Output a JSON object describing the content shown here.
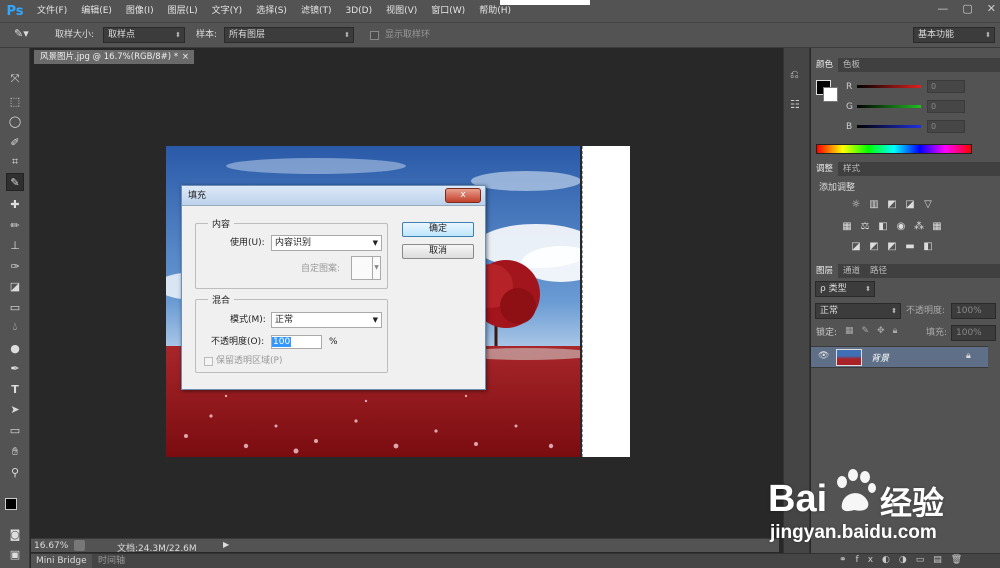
{
  "app": {
    "logo": "Ps"
  },
  "menu": [
    "文件(F)",
    "编辑(E)",
    "图像(I)",
    "图层(L)",
    "文字(Y)",
    "选择(S)",
    "滤镜(T)",
    "3D(D)",
    "视图(V)",
    "窗口(W)",
    "帮助(H)"
  ],
  "window_controls": {
    "minimize": "—",
    "restore": "▢",
    "close": "✕"
  },
  "options": {
    "sample_size_label": "取样大小:",
    "sample_size_value": "取样点",
    "sample_label": "样本:",
    "sample_value": "所有图层",
    "show_ring_label": "显示取样环",
    "workspace_value": "基本功能"
  },
  "document": {
    "tab_title": "风景图片.jpg @ 16.7%(RGB/8#) *",
    "close_glyph": "×"
  },
  "dialog": {
    "title": "填充",
    "close_glyph": "x",
    "content_group_title": "内容",
    "use_label": "使用(U):",
    "use_value": "内容识别",
    "custom_pattern_label": "自定图案:",
    "blend_group_title": "混合",
    "mode_label": "模式(M):",
    "mode_value": "正常",
    "opacity_label": "不透明度(O):",
    "opacity_value": "100",
    "opacity_unit": "%",
    "preserve_label": "保留透明区域(P)",
    "ok_label": "确定",
    "cancel_label": "取消"
  },
  "color_panel": {
    "tabs": [
      "颜色",
      "色板"
    ],
    "channels": [
      {
        "label": "R",
        "value": "0",
        "color": "#e02020"
      },
      {
        "label": "G",
        "value": "0",
        "color": "#20c020"
      },
      {
        "label": "B",
        "value": "0",
        "color": "#2030e0"
      }
    ]
  },
  "adjust_panel": {
    "tabs": [
      "调整",
      "样式"
    ],
    "add_label": "添加调整",
    "icons": [
      "brightness-icon",
      "levels-icon",
      "curves-icon",
      "exposure-icon",
      "vibrance-icon",
      "hue-saturation-icon",
      "color-balance-icon",
      "black-white-icon",
      "photo-filter-icon",
      "channel-mixer-icon",
      "color-lookup-icon",
      "invert-icon",
      "posterize-icon",
      "threshold-icon",
      "gradient-map-icon",
      "selective-color-icon"
    ]
  },
  "layers_panel": {
    "tabs": [
      "图层",
      "通道",
      "路径"
    ],
    "filter_label": "ρ 类型",
    "blend_mode": "正常",
    "opacity_label": "不透明度:",
    "opacity_value": "100%",
    "lock_label": "锁定:",
    "fill_label": "填充:",
    "fill_value": "100%",
    "layer_name": "背景"
  },
  "status": {
    "zoom": "16.67%",
    "doc_info": "文档:24.3M/22.6M"
  },
  "bottom_tabs": [
    "Mini Bridge",
    "时间轴"
  ],
  "watermark": {
    "brand": "Bai",
    "brand2": "du",
    "jingyan": "经验",
    "url": "jingyan.baidu.com"
  }
}
